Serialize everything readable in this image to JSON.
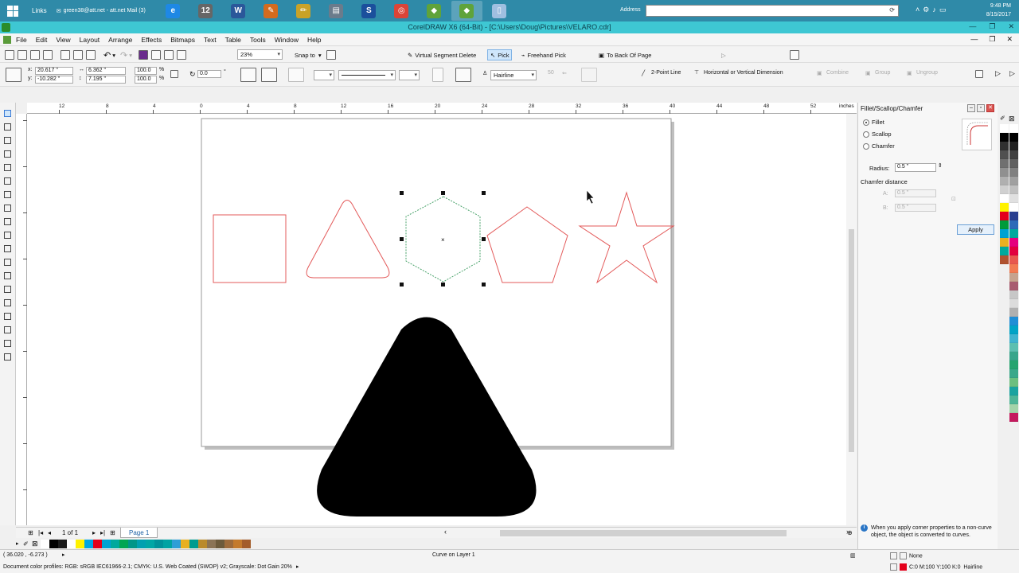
{
  "taskbar": {
    "links_label": "Links",
    "mail_item": "green38@att.net - att.net Mail (3)",
    "apps": [
      {
        "icon": "ie-icon",
        "glyph": "e",
        "color": "#1e88e5",
        "active": false
      },
      {
        "icon": "calendar-icon",
        "glyph": "12",
        "color": "#666666",
        "active": false
      },
      {
        "icon": "word-icon",
        "glyph": "W",
        "color": "#2b579a",
        "active": false
      },
      {
        "icon": "paint-tool-icon",
        "glyph": "✎",
        "color": "#d46b1d",
        "active": false
      },
      {
        "icon": "pencil-icon",
        "glyph": "✏",
        "color": "#c9a227",
        "active": false
      },
      {
        "icon": "scanner-icon",
        "glyph": "▤",
        "color": "#6b7b8b",
        "active": false
      },
      {
        "icon": "s-app-icon",
        "glyph": "S",
        "color": "#1b4f9c",
        "active": false
      },
      {
        "icon": "chrome-icon",
        "glyph": "◎",
        "color": "#db4437",
        "active": false
      },
      {
        "icon": "coreldraw-icon",
        "glyph": "◆",
        "color": "#5fa33a",
        "active": false
      },
      {
        "icon": "coreldraw-active-icon",
        "glyph": "◆",
        "color": "#5fa33a",
        "active": true
      },
      {
        "icon": "file-icon",
        "glyph": "▯",
        "color": "#9fbfe0",
        "active": false
      }
    ],
    "address_label": "Address",
    "clock_time": "9:48 PM",
    "clock_date": "8/15/2017"
  },
  "titlebar": {
    "title": "CorelDRAW X6 (64-Bit) - [C:\\Users\\Doug\\Pictures\\VELARO.cdr]"
  },
  "menus": [
    "File",
    "Edit",
    "View",
    "Layout",
    "Arrange",
    "Effects",
    "Bitmaps",
    "Text",
    "Table",
    "Tools",
    "Window",
    "Help"
  ],
  "standard_toolbar": {
    "zoom": "23%",
    "snap_to": "Snap to",
    "virtual_segment_delete": "Virtual Segment Delete",
    "pick": "Pick",
    "freehand_pick": "Freehand Pick",
    "to_back_of_page": "To Back Of Page"
  },
  "property_bar": {
    "x": "20.617 \"",
    "y": "-10.282 \"",
    "width": "6.362 \"",
    "height": "7.195 \"",
    "scale_w": "100.0",
    "scale_h": "100.0",
    "pct": "%",
    "rotation": "0.0",
    "degree": "°",
    "outline_width": "Hairline",
    "value_50": "50",
    "two_point_line": "2-Point Line",
    "dimension": "Horizontal or Vertical Dimension",
    "combine": "Combine",
    "group": "Group",
    "ungroup": "Ungroup"
  },
  "ruler": {
    "h_ticks": [
      "12",
      "8",
      "4",
      "0",
      "4",
      "8",
      "12",
      "16",
      "20",
      "24",
      "28",
      "32",
      "36",
      "40",
      "44",
      "48",
      "52"
    ],
    "units": "inches"
  },
  "docker": {
    "title": "Fillet/Scallop/Chamfer",
    "options": [
      {
        "label": "Fillet",
        "checked": true
      },
      {
        "label": "Scallop",
        "checked": false
      },
      {
        "label": "Chamfer",
        "checked": false
      }
    ],
    "radius_label": "Radius:",
    "radius_value": "0.5 \"",
    "chamfer_distance_label": "Chamfer distance",
    "a_label": "A:",
    "a_value": "0.5 \"",
    "b_label": "B:",
    "b_value": "0.5 \"",
    "apply_label": "Apply",
    "info_text": "When you apply corner properties to a non-curve object, the object is converted to curves."
  },
  "page_nav": {
    "page_count": "1 of 1",
    "page_tab": "Page 1"
  },
  "status": {
    "cursor_coords": "( 36.020 , -6.273 )",
    "selection_info": "Curve on Layer 1",
    "color_profiles": "Document color profiles: RGB: sRGB IEC61966-2.1; CMYK: U.S. Web Coated (SWOP) v2; Grayscale: Dot Gain 20%",
    "fill_label": "None",
    "outline_color": "C:0 M:100 Y:100 K:0",
    "outline_width": "Hairline"
  },
  "colors": {
    "taskbar": "#2f8aa8",
    "titlebar": "#3ec7d3",
    "shape_outline": "#e35a5a",
    "selected_outline": "#4aa36b",
    "filled_shape": "#000000"
  },
  "doc_palette": [
    "#ffffff",
    "#000000",
    "#1a1a1a",
    "#ffffff",
    "#fff200",
    "#00a6e4",
    "#e4001b",
    "#00a2d3",
    "#00a99d",
    "#00a651",
    "#009688",
    "#00a0b0",
    "#00a6a6",
    "#00929a",
    "#00a3a3",
    "#2e9ed6",
    "#e8b021",
    "#009b8f",
    "#ba8a2b",
    "#8b7355",
    "#6d5a3b",
    "#9e6b3b",
    "#c47a2c",
    "#a35c2a"
  ],
  "right_palette_col1": [
    "#ffffff",
    "#000000",
    "#303030",
    "#505050",
    "#707070",
    "#909090",
    "#b0b0b0",
    "#d0d0d0",
    "#ffffff",
    "#fff200",
    "#e4001b",
    "#009b3a",
    "#00a2d3",
    "#e8b021",
    "#00a99d",
    "#b0522f"
  ],
  "right_palette_col2": [
    "#ffffff",
    "#000000",
    "#202020",
    "#404040",
    "#606060",
    "#808080",
    "#a0a0a0",
    "#c0c0c0",
    "#e0e0e0",
    "#ffffff",
    "#2a3f8f",
    "#2d6ab8",
    "#00a99d",
    "#e5007e",
    "#e2003f",
    "#e8584f",
    "#f27b53",
    "#c6a38e",
    "#a85b6f",
    "#c7c7c7",
    "#dcdcdc",
    "#b0b0b0",
    "#1f8ed6",
    "#00a3c6",
    "#3fb3cf",
    "#5cbfb0",
    "#38a58b",
    "#27a470",
    "#3aa88a",
    "#6cbf7f",
    "#1aa3a0",
    "#4fb598",
    "#a4d3a9",
    "#c41a5e"
  ]
}
